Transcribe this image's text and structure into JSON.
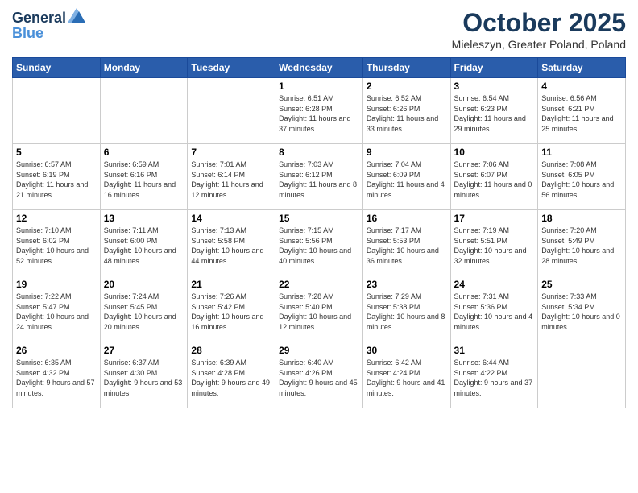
{
  "header": {
    "logo_line1": "General",
    "logo_line2": "Blue",
    "month": "October 2025",
    "location": "Mieleszyn, Greater Poland, Poland"
  },
  "weekdays": [
    "Sunday",
    "Monday",
    "Tuesday",
    "Wednesday",
    "Thursday",
    "Friday",
    "Saturday"
  ],
  "weeks": [
    [
      {
        "day": "",
        "info": ""
      },
      {
        "day": "",
        "info": ""
      },
      {
        "day": "",
        "info": ""
      },
      {
        "day": "1",
        "info": "Sunrise: 6:51 AM\nSunset: 6:28 PM\nDaylight: 11 hours\nand 37 minutes."
      },
      {
        "day": "2",
        "info": "Sunrise: 6:52 AM\nSunset: 6:26 PM\nDaylight: 11 hours\nand 33 minutes."
      },
      {
        "day": "3",
        "info": "Sunrise: 6:54 AM\nSunset: 6:23 PM\nDaylight: 11 hours\nand 29 minutes."
      },
      {
        "day": "4",
        "info": "Sunrise: 6:56 AM\nSunset: 6:21 PM\nDaylight: 11 hours\nand 25 minutes."
      }
    ],
    [
      {
        "day": "5",
        "info": "Sunrise: 6:57 AM\nSunset: 6:19 PM\nDaylight: 11 hours\nand 21 minutes."
      },
      {
        "day": "6",
        "info": "Sunrise: 6:59 AM\nSunset: 6:16 PM\nDaylight: 11 hours\nand 16 minutes."
      },
      {
        "day": "7",
        "info": "Sunrise: 7:01 AM\nSunset: 6:14 PM\nDaylight: 11 hours\nand 12 minutes."
      },
      {
        "day": "8",
        "info": "Sunrise: 7:03 AM\nSunset: 6:12 PM\nDaylight: 11 hours\nand 8 minutes."
      },
      {
        "day": "9",
        "info": "Sunrise: 7:04 AM\nSunset: 6:09 PM\nDaylight: 11 hours\nand 4 minutes."
      },
      {
        "day": "10",
        "info": "Sunrise: 7:06 AM\nSunset: 6:07 PM\nDaylight: 11 hours\nand 0 minutes."
      },
      {
        "day": "11",
        "info": "Sunrise: 7:08 AM\nSunset: 6:05 PM\nDaylight: 10 hours\nand 56 minutes."
      }
    ],
    [
      {
        "day": "12",
        "info": "Sunrise: 7:10 AM\nSunset: 6:02 PM\nDaylight: 10 hours\nand 52 minutes."
      },
      {
        "day": "13",
        "info": "Sunrise: 7:11 AM\nSunset: 6:00 PM\nDaylight: 10 hours\nand 48 minutes."
      },
      {
        "day": "14",
        "info": "Sunrise: 7:13 AM\nSunset: 5:58 PM\nDaylight: 10 hours\nand 44 minutes."
      },
      {
        "day": "15",
        "info": "Sunrise: 7:15 AM\nSunset: 5:56 PM\nDaylight: 10 hours\nand 40 minutes."
      },
      {
        "day": "16",
        "info": "Sunrise: 7:17 AM\nSunset: 5:53 PM\nDaylight: 10 hours\nand 36 minutes."
      },
      {
        "day": "17",
        "info": "Sunrise: 7:19 AM\nSunset: 5:51 PM\nDaylight: 10 hours\nand 32 minutes."
      },
      {
        "day": "18",
        "info": "Sunrise: 7:20 AM\nSunset: 5:49 PM\nDaylight: 10 hours\nand 28 minutes."
      }
    ],
    [
      {
        "day": "19",
        "info": "Sunrise: 7:22 AM\nSunset: 5:47 PM\nDaylight: 10 hours\nand 24 minutes."
      },
      {
        "day": "20",
        "info": "Sunrise: 7:24 AM\nSunset: 5:45 PM\nDaylight: 10 hours\nand 20 minutes."
      },
      {
        "day": "21",
        "info": "Sunrise: 7:26 AM\nSunset: 5:42 PM\nDaylight: 10 hours\nand 16 minutes."
      },
      {
        "day": "22",
        "info": "Sunrise: 7:28 AM\nSunset: 5:40 PM\nDaylight: 10 hours\nand 12 minutes."
      },
      {
        "day": "23",
        "info": "Sunrise: 7:29 AM\nSunset: 5:38 PM\nDaylight: 10 hours\nand 8 minutes."
      },
      {
        "day": "24",
        "info": "Sunrise: 7:31 AM\nSunset: 5:36 PM\nDaylight: 10 hours\nand 4 minutes."
      },
      {
        "day": "25",
        "info": "Sunrise: 7:33 AM\nSunset: 5:34 PM\nDaylight: 10 hours\nand 0 minutes."
      }
    ],
    [
      {
        "day": "26",
        "info": "Sunrise: 6:35 AM\nSunset: 4:32 PM\nDaylight: 9 hours\nand 57 minutes."
      },
      {
        "day": "27",
        "info": "Sunrise: 6:37 AM\nSunset: 4:30 PM\nDaylight: 9 hours\nand 53 minutes."
      },
      {
        "day": "28",
        "info": "Sunrise: 6:39 AM\nSunset: 4:28 PM\nDaylight: 9 hours\nand 49 minutes."
      },
      {
        "day": "29",
        "info": "Sunrise: 6:40 AM\nSunset: 4:26 PM\nDaylight: 9 hours\nand 45 minutes."
      },
      {
        "day": "30",
        "info": "Sunrise: 6:42 AM\nSunset: 4:24 PM\nDaylight: 9 hours\nand 41 minutes."
      },
      {
        "day": "31",
        "info": "Sunrise: 6:44 AM\nSunset: 4:22 PM\nDaylight: 9 hours\nand 37 minutes."
      },
      {
        "day": "",
        "info": ""
      }
    ]
  ]
}
